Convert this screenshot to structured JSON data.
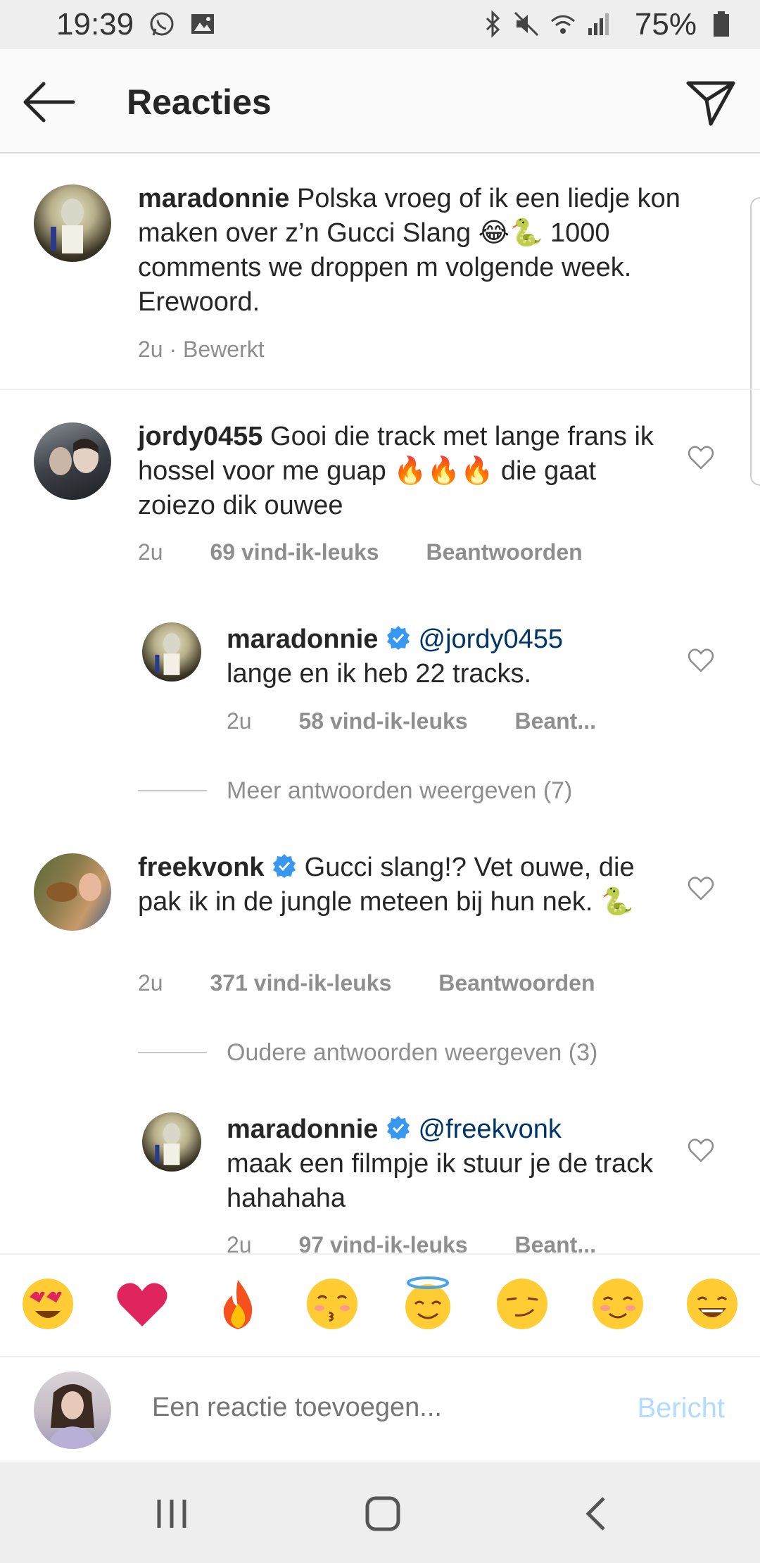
{
  "status": {
    "time": "19:39",
    "battery": "75%"
  },
  "header": {
    "title": "Reacties"
  },
  "caption": {
    "username": "maradonnie",
    "text": " Polska vroeg of ik een liedje kon maken over z’n Gucci Slang 😂🐍 1000 comments we droppen m volgende week. Erewoord.",
    "meta": "2u · Bewerkt"
  },
  "comments": [
    {
      "username": "jordy0455",
      "text": " Gooi die track met lange frans ik hossel voor me guap 🔥🔥🔥 die gaat zoiezo dik ouwee",
      "time": "2u",
      "likes": "69 vind-ik-leuks",
      "reply": "Beantwoorden"
    },
    {
      "username": "maradonnie",
      "mention": "@jordy0455",
      "text": " lange en ik heb 22 tracks.",
      "time": "2u",
      "likes": "58 vind-ik-leuks",
      "reply": "Beant..."
    },
    {
      "username": "freekvonk",
      "text": " Gucci slang!? Vet ouwe, die pak ik in de jungle meteen bij hun nek. 🐍",
      "time": "2u",
      "likes": "371 vind-ik-leuks",
      "reply": "Beantwoorden"
    },
    {
      "username": "maradonnie",
      "mention": "@freekvonk",
      "text": " maak een filmpje ik stuur je de track hahahaha",
      "time": "2u",
      "likes": "97 vind-ik-leuks",
      "reply": "Beant..."
    }
  ],
  "more_replies_1": "Meer antwoorden weergeven (7)",
  "more_replies_2": "Oudere antwoorden weergeven (3)",
  "emojis": [
    "😍",
    "❤️",
    "🔥",
    "😚",
    "😇",
    "😏",
    "😊",
    "😄"
  ],
  "composer": {
    "placeholder": "Een reactie toevoegen...",
    "post_label": "Bericht"
  },
  "colors": {
    "verified": "#3897f0",
    "post_disabled": "#b3dbff",
    "mention": "#003569"
  }
}
